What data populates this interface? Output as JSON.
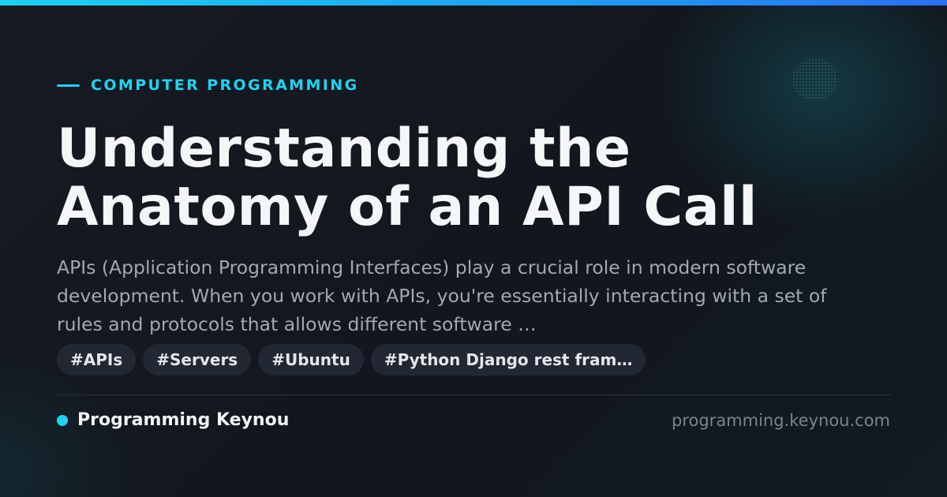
{
  "category": "COMPUTER PROGRAMMING",
  "title": "Understanding the Anatomy of an API Call",
  "excerpt": "APIs (Application Programming Interfaces) play a crucial role in modern software development. When you work with APIs, you're essentially interacting with a set of rules and protocols that allows different software …",
  "tags": [
    "#APIs",
    "#Servers",
    "#Ubuntu",
    "#Python Django rest fram…"
  ],
  "brand": "Programming Keynou",
  "site_url": "programming.keynou.com",
  "colors": {
    "accent": "#1dd4f0",
    "background": "#13171f",
    "tag_background": "#222833"
  }
}
